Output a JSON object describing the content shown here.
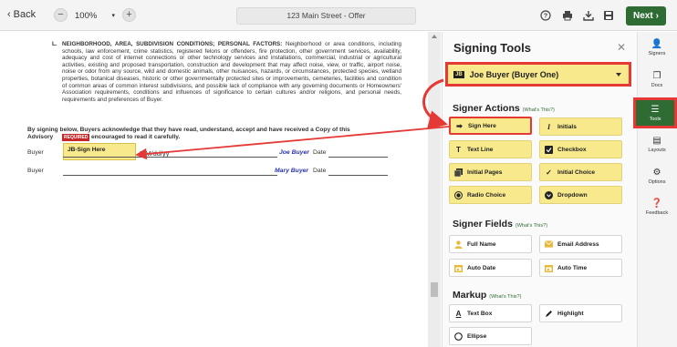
{
  "toolbar": {
    "back_label": "Back",
    "zoom_value": "100%",
    "doc_title": "123 Main Street - Offer",
    "next_label": "Next"
  },
  "document": {
    "paragraph_letter": "L.",
    "paragraph_heading": "NEIGHBORHOOD, AREA, SUBDIVISION CONDITIONS; PERSONAL FACTORS:",
    "paragraph_body": "Neighborhood or area conditions, including schools, law enforcement, crime statistics, registered felons or offenders, fire protection, other government services, availability, adequacy and cost of internet connections or other technology services and installations, commercial, industrial or agricultural activities, existing and proposed transportation, construction and development that may affect noise, view, or traffic, airport noise, noise or odor from any source, wild and domestic animals, other nuisances, hazards, or circumstances, protected species, wetland properties, botanical diseases, historic or other governmentally protected sites or improvements, cemeteries, facilities and condition of common areas of common interest subdivisions, and possible lack of compliance with any governing documents or Homeowners' Association requirements, conditions and influences of significance to certain cultures and/or religions, and personal needs, requirements and preferences of Buyer.",
    "ack_line1": "By signing below, Buyers acknowledge that they have read, understand, accept and have received a Copy of this",
    "ack_line2_start": "Advisory",
    "ack_line2_end": "are encouraged to read it carefully.",
    "required_tag": "REQUIRED",
    "sign_here_field": "JB-Sign Here",
    "date_placeholder": "MM/dd/yy",
    "rows": [
      {
        "label": "Buyer",
        "name": "Joe Buyer",
        "date_label": "Date"
      },
      {
        "label": "Buyer",
        "name": "Mary Buyer",
        "date_label": "Date"
      }
    ]
  },
  "panel": {
    "title": "Signing Tools",
    "signer_initials": "JB",
    "signer_name": "Joe Buyer (Buyer One)",
    "whats_this": "(What's This?)",
    "sections": {
      "actions": "Signer Actions",
      "fields": "Signer Fields",
      "markup": "Markup"
    },
    "actions": [
      "Sign Here",
      "Initials",
      "Text Line",
      "Checkbox",
      "Initial Pages",
      "Initial Choice",
      "Radio Choice",
      "Dropdown"
    ],
    "fields": [
      "Full Name",
      "Email Address",
      "Auto Date",
      "Auto Time"
    ],
    "markup": [
      "Text Box",
      "Highlight",
      "Ellipse"
    ]
  },
  "sidebar": {
    "items": [
      "Signers",
      "Docs",
      "Tools",
      "Layouts",
      "Options",
      "Feedback"
    ]
  },
  "colors": {
    "accent_green": "#2f6c34",
    "tool_yellow": "#f7e98c",
    "highlight_red": "#e53935",
    "signer_blue": "#2732b3"
  }
}
